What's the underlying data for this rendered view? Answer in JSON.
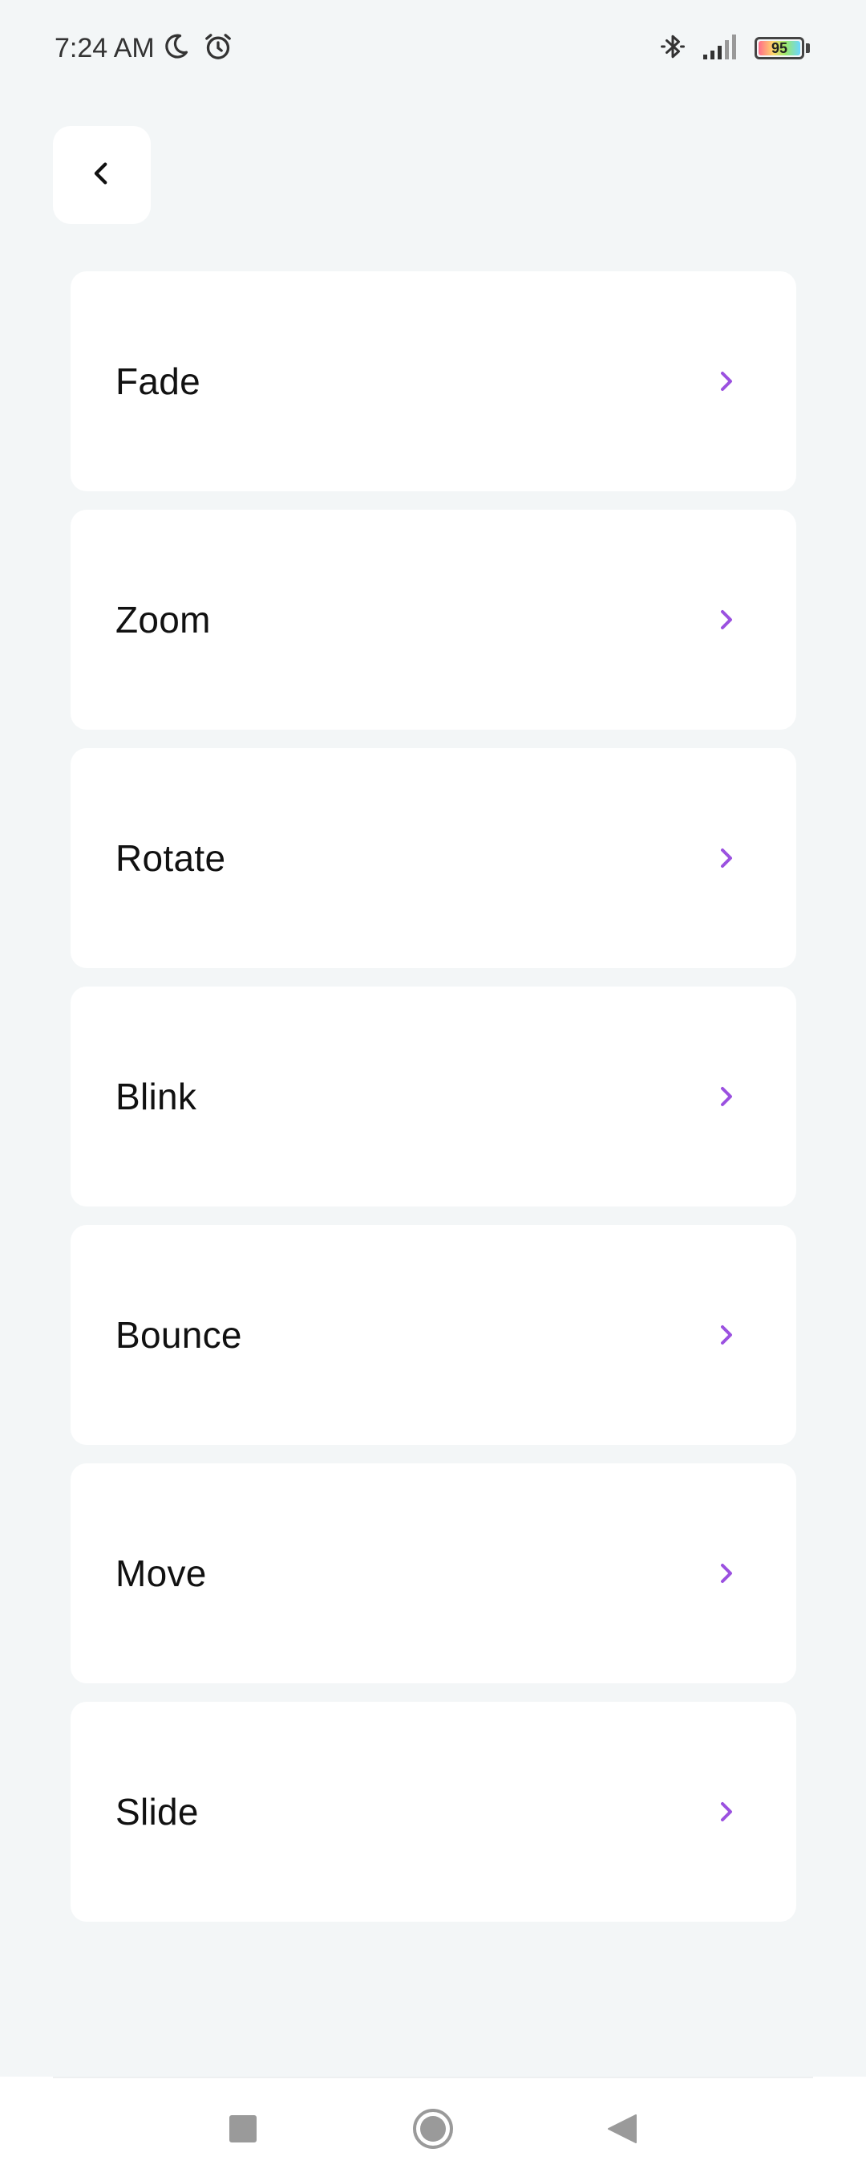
{
  "status_bar": {
    "time": "7:24 AM",
    "battery_level": "95",
    "icons": [
      "moon-icon",
      "alarm-icon",
      "bluetooth-icon",
      "signal-icon",
      "battery-icon"
    ]
  },
  "header": {
    "back_icon": "chevron-left-icon"
  },
  "animations": {
    "items": [
      {
        "label": "Fade"
      },
      {
        "label": "Zoom"
      },
      {
        "label": "Rotate"
      },
      {
        "label": "Blink"
      },
      {
        "label": "Bounce"
      },
      {
        "label": "Move"
      },
      {
        "label": "Slide"
      }
    ],
    "chevron_icon": "chevron-right-icon"
  },
  "navigation_bar": {
    "buttons": [
      "recents-square-icon",
      "home-circle-icon",
      "back-triangle-icon"
    ]
  },
  "colors": {
    "background": "#F3F6F7",
    "card": "#FFFFFF",
    "accent": "#9B51E0",
    "text": "#111111"
  }
}
